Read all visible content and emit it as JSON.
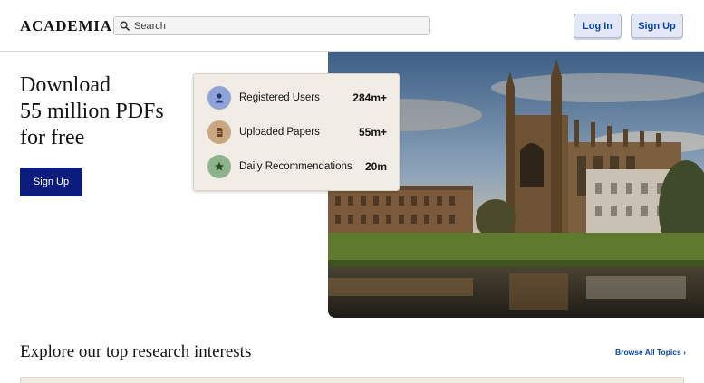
{
  "header": {
    "logo": "ACADEMIA",
    "search_placeholder": "Search",
    "login_label": "Log In",
    "signup_label": "Sign Up"
  },
  "hero": {
    "headline_lines": [
      "Download",
      "55 million PDFs",
      "for free"
    ],
    "signup_label": "Sign Up"
  },
  "stats": [
    {
      "icon": "user-icon",
      "label": "Registered Users",
      "value": "284m+",
      "color": "#8fa3d6"
    },
    {
      "icon": "document-icon",
      "label": "Uploaded Papers",
      "value": "55m+",
      "color": "#c9a781"
    },
    {
      "icon": "star-icon",
      "label": "Daily Recommendations",
      "value": "20m",
      "color": "#8db38c"
    }
  ],
  "explore": {
    "title": "Explore our top research interests",
    "browse_label": "Browse All Topics ›"
  },
  "colors": {
    "brand_dark": "#0b1c7d",
    "link_blue": "#0645b1"
  }
}
